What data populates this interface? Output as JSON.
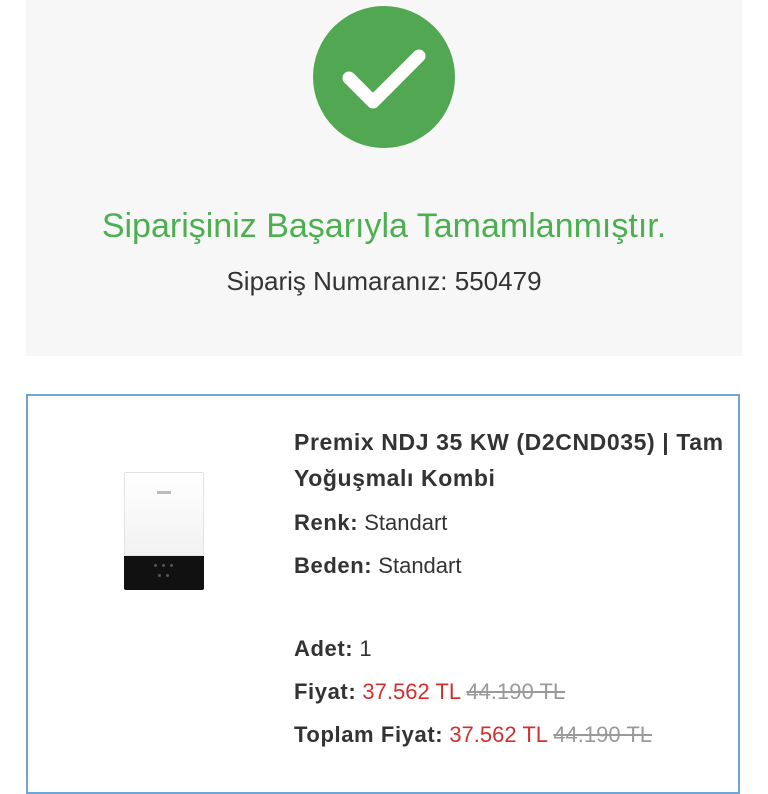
{
  "success": {
    "title": "Siparişiniz Başarıyla Tamamlanmıştır.",
    "order_number_label": "Sipariş Numaranız:",
    "order_number": "550479",
    "icon": "check-icon",
    "accent_color": "#52a852"
  },
  "product": {
    "image_icon": "combi-boiler-image",
    "title": "Premix NDJ 35 KW (D2CND035) | Tam Yoğuşmalı Kombi",
    "color_label": "Renk:",
    "color_value": "Standart",
    "size_label": "Beden:",
    "size_value": "Standart",
    "quantity_label": "Adet:",
    "quantity_value": "1",
    "price_label": "Fiyat:",
    "price_current": "37.562 TL",
    "price_old": "44.190 TL",
    "total_label": "Toplam Fiyat:",
    "total_current": "37.562 TL",
    "total_old": "44.190 TL",
    "price_color": "#d32f2f",
    "border_color": "#6fa6d6"
  }
}
